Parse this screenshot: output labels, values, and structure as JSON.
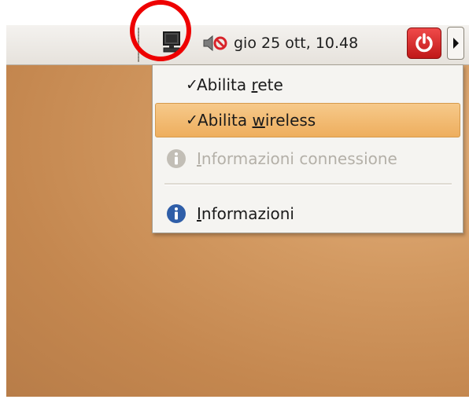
{
  "panel": {
    "clock_text": "gio 25 ott, 10.48",
    "network_icon": "network-wired-icon",
    "volume_icon": "volume-muted-icon",
    "power_icon": "power-icon",
    "arrow_icon": "arrow-right-icon"
  },
  "menu": {
    "items": [
      {
        "prefix": "Abilita ",
        "mnemonic": "r",
        "suffix": "ete",
        "checked": true,
        "enabled": true
      },
      {
        "prefix": "Abilita ",
        "mnemonic": "w",
        "suffix": "ireless",
        "checked": true,
        "enabled": true,
        "highlighted": true
      },
      {
        "prefix": "",
        "mnemonic": "I",
        "suffix": "nformazioni connessione",
        "enabled": false,
        "icon": "info-icon"
      },
      {
        "prefix": "",
        "mnemonic": "I",
        "suffix": "nformazioni",
        "enabled": true,
        "icon": "info-icon"
      }
    ],
    "check_glyph": "✓"
  },
  "colors": {
    "annotation_circle": "#ee0000",
    "highlight": "#eeae5e",
    "info_icon_active": "#2f5ea8",
    "info_icon_disabled": "#c2beb6",
    "power_button": "#d82020"
  }
}
